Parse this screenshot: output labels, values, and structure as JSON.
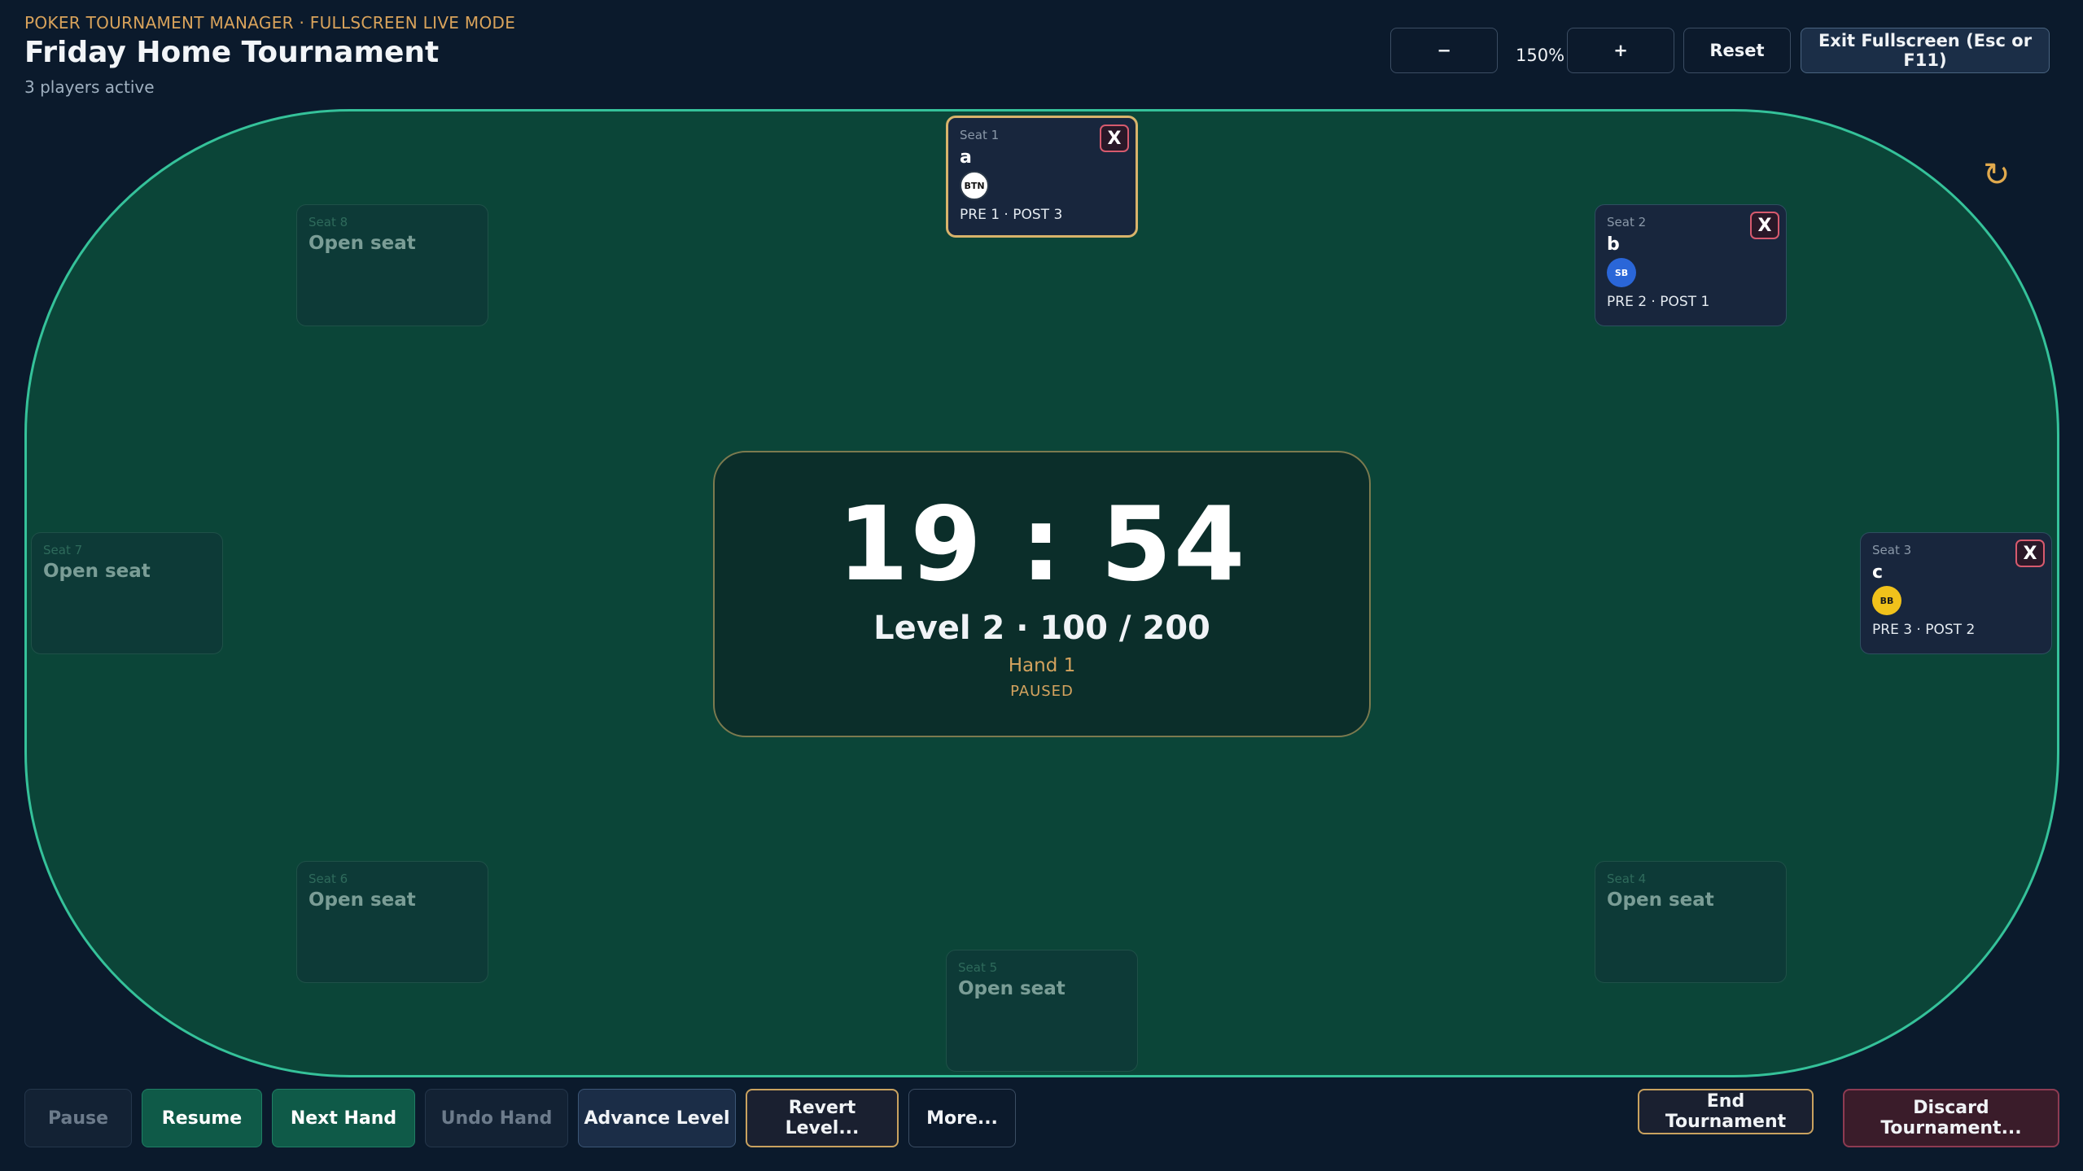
{
  "header": {
    "kicker": "POKER TOURNAMENT MANAGER · FULLSCREEN LIVE MODE",
    "title": "Friday Home Tournament",
    "subtitle": "3 players active"
  },
  "toolbar": {
    "zoom_out": "−",
    "zoom_level": "150%",
    "zoom_in": "+",
    "reset": "Reset",
    "exit_fullscreen": "Exit Fullscreen (Esc or F11)"
  },
  "table": {
    "reset_icon": "↻",
    "remove_label": "X",
    "open_text": "Open seat",
    "seats": [
      {
        "label": "Seat 1",
        "name": "a",
        "badge": "BTN",
        "stats": "PRE 1 · POST 3"
      },
      {
        "label": "Seat 2",
        "name": "b",
        "badge": "SB",
        "stats": "PRE 2 · POST 1"
      },
      {
        "label": "Seat 3",
        "name": "c",
        "badge": "BB",
        "stats": "PRE 3 · POST 2"
      },
      {
        "label": "Seat 4"
      },
      {
        "label": "Seat 5"
      },
      {
        "label": "Seat 6"
      },
      {
        "label": "Seat 7"
      },
      {
        "label": "Seat 8"
      }
    ]
  },
  "clock": {
    "time": "19 : 54",
    "level": "Level 2 · 100 / 200",
    "hand": "Hand 1",
    "status": "PAUSED"
  },
  "controls": {
    "pause": "Pause",
    "resume": "Resume",
    "next_hand": "Next Hand",
    "undo_hand": "Undo Hand",
    "advance_level": "Advance Level",
    "revert_level": "Revert Level...",
    "more": "More...",
    "end_tournament": "End Tournament",
    "discard_tournament": "Discard Tournament..."
  },
  "colors": {
    "felt": "#0b4538",
    "rail": "#35c29a",
    "accent_gold": "#d8b36b"
  }
}
